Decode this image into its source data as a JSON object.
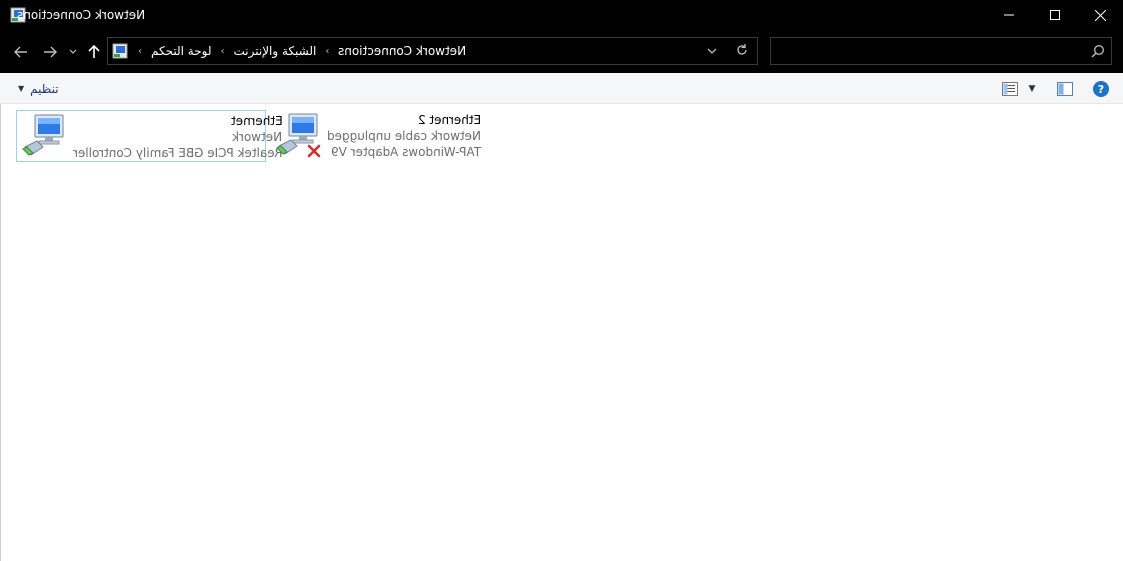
{
  "window": {
    "title": "Network Connections",
    "controls": {
      "minimize": "minimize-icon",
      "maximize": "maximize-icon",
      "close": "close-icon"
    }
  },
  "navigation": {
    "back": "arrow-left-icon",
    "forward": "arrow-right-icon",
    "recent": "chevron-down-icon",
    "up": "arrow-up-icon"
  },
  "address": {
    "breadcrumbs": [
      "لوحة التحكم",
      "الشبكة والإنترنت",
      "Network Connections"
    ],
    "separator": "‹"
  },
  "search": {
    "value": "",
    "placeholder": ""
  },
  "command_bar": {
    "organize_label": "تنظيم"
  },
  "connections": [
    {
      "name": "Ethernet",
      "status": "Network",
      "adapter": "Realtek PCIe GBE Family Controller",
      "selected": true,
      "disconnected": false
    },
    {
      "name": "Ethernet 2",
      "status": "Network cable unplugged",
      "adapter": "TAP-Windows Adapter V9",
      "selected": false,
      "disconnected": true
    }
  ],
  "colors": {
    "chrome": "#000000",
    "accent_link": "#1e3287",
    "selection_border": "#99d1ff",
    "error_red": "#d32f2f",
    "help_blue": "#1a73c7"
  }
}
